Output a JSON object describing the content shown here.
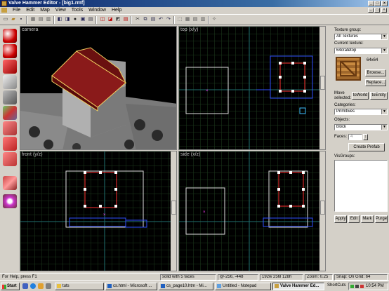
{
  "window": {
    "title": "Valve Hammer Editor - [big1.rmf]"
  },
  "menu": {
    "items": [
      "File",
      "Edit",
      "Map",
      "View",
      "Tools",
      "Window",
      "Help"
    ]
  },
  "views": {
    "camera": {
      "label": "camera"
    },
    "top": {
      "label": "top (x/y)"
    },
    "front": {
      "label": "front (y/z)"
    },
    "side": {
      "label": "side (x/z)"
    }
  },
  "panel": {
    "texture_group_label": "Texture group:",
    "texture_group_value": "All Textures",
    "current_texture_label": "Current texture:",
    "current_texture_value": "64cratetop",
    "texture_size": "64x64",
    "browse_label": "Browse...",
    "replace_label": "Replace...",
    "move_selected_label": "Move selected:",
    "to_world_label": "toWorld",
    "to_entity_label": "toEntity",
    "categories_label": "Categories:",
    "categories_value": "Primitives",
    "objects_label": "Objects:",
    "objects_value": "block",
    "faces_label": "Faces:",
    "faces_value": "4",
    "create_prefab_label": "Create Prefab",
    "visgroups_label": "VisGroups:",
    "apply_label": "Apply",
    "edit_label": "Edit",
    "mark_label": "Mark",
    "purge_label": "Purge"
  },
  "status": {
    "help": "For Help, press F1",
    "selection": "solid with 5 faces",
    "coords": "@-256, -448",
    "size": "192w 256l 128h",
    "zoom": "Zoom: 0.25",
    "snap": "Snap: On Grid: 64"
  },
  "taskbar": {
    "start": "Start",
    "tasks": [
      {
        "label": "tuts",
        "active": false
      },
      {
        "label": "cs.html - Microsoft ...",
        "active": false
      },
      {
        "label": "cs_page10.htm - Mi...",
        "active": false
      },
      {
        "label": "Untitled - Notepad",
        "active": false
      },
      {
        "label": "Valve Hammer Ed...",
        "active": true
      }
    ],
    "shortcuts": "ShortCuts",
    "time": "10:54 PM"
  },
  "colors": {
    "accent": "#0a246a",
    "grid": "#1e3b1e",
    "selection": "#ff3030",
    "brush": "#e0e0e0"
  }
}
